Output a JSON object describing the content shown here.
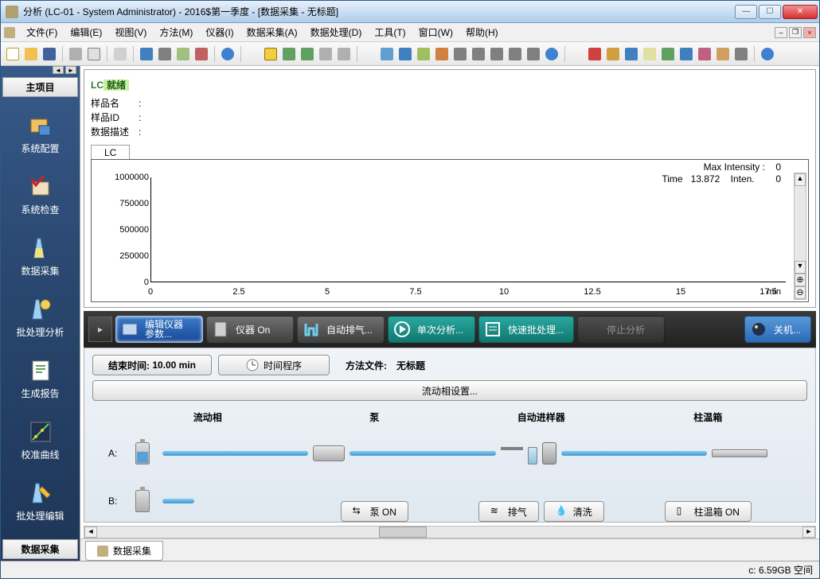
{
  "window": {
    "title": "分析 (LC-01 - System Administrator) - 2016$第一季度 - [数据采集 - 无标题]"
  },
  "menu": {
    "file": "文件(F)",
    "edit": "编辑(E)",
    "view": "视图(V)",
    "method": "方法(M)",
    "instrument": "仪器(I)",
    "acquire": "数据采集(A)",
    "process": "数据处理(D)",
    "tools": "工具(T)",
    "window": "窗口(W)",
    "help": "帮助(H)"
  },
  "sidebar": {
    "header": "主项目",
    "footer": "数据采集",
    "items": [
      {
        "label": "系统配置",
        "icon": "config"
      },
      {
        "label": "系统检查",
        "icon": "check"
      },
      {
        "label": "数据采集",
        "icon": "acquire"
      },
      {
        "label": "批处理分析",
        "icon": "batch"
      },
      {
        "label": "生成报告",
        "icon": "report"
      },
      {
        "label": "校准曲线",
        "icon": "calib"
      },
      {
        "label": "批处理编辑",
        "icon": "batchedit"
      }
    ]
  },
  "status_panel": {
    "lc_prefix": "LC",
    "lc_state": "就绪",
    "rows": {
      "sample_name_k": "样品名",
      "sample_name_v": "",
      "sample_id_k": "样品ID",
      "sample_id_v": "",
      "data_desc_k": "数据描述",
      "data_desc_v": ""
    },
    "tab": "LC"
  },
  "chart_data": {
    "type": "line",
    "title": "",
    "xlabel": "min",
    "ylabel": "",
    "xlim": [
      0.0,
      17.5
    ],
    "ylim": [
      0,
      1000000
    ],
    "x_ticks": [
      0.0,
      2.5,
      5.0,
      7.5,
      10.0,
      12.5,
      15.0,
      17.5
    ],
    "y_ticks": [
      0,
      250000,
      500000,
      750000,
      1000000
    ],
    "series": [
      {
        "name": "LC",
        "x": [],
        "y": []
      }
    ],
    "cursor": {
      "time": 13.872,
      "intensity": 0.0
    },
    "max_intensity_label": "Max Intensity :",
    "max_intensity": 0,
    "time_label": "Time",
    "inten_label": "Inten."
  },
  "actions": {
    "edit_params": "编辑仪器\n参数...",
    "inst_on": "仪器 On",
    "auto_purge": "自动排气...",
    "single": "单次分析...",
    "quick_batch": "快速批处理...",
    "stop": "停止分析",
    "shutdown": "关机..."
  },
  "settings": {
    "end_time_label": "结束时间:",
    "end_time_value": "10.00 min",
    "time_prog": "时间程序",
    "method_file_label": "方法文件:",
    "method_file_value": "无标题",
    "mobile_phase_btn": "流动相设置...",
    "headers": {
      "phase": "流动相",
      "pump": "泵",
      "sampler": "自动进样器",
      "oven": "柱温箱"
    },
    "channels": {
      "a": "A:",
      "b": "B:"
    },
    "buttons": {
      "pump_on": "泵 ON",
      "purge": "排气",
      "rinse": "清洗",
      "oven_on": "柱温箱 ON"
    }
  },
  "bottom_tab": "数据采集",
  "statusbar": {
    "disk": "c:   6.59GB 空间"
  }
}
